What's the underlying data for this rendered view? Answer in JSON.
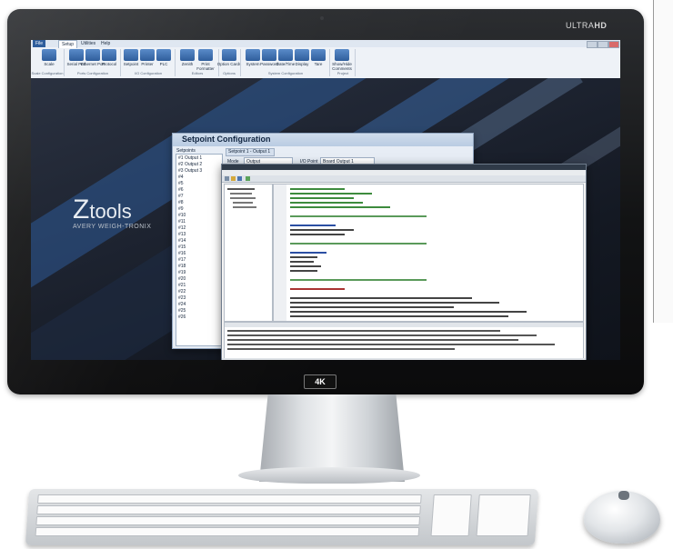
{
  "monitor": {
    "brand_label_light": "ULTRA",
    "brand_label_bold": "HD",
    "badge": "4K"
  },
  "menubar": {
    "items": [
      "File",
      "Setup",
      "Utilities",
      "Help"
    ]
  },
  "ribbon": {
    "buttons": [
      "Scale",
      "Serial Port",
      "Ethernet Port",
      "Protocol",
      "Setpoint",
      "Printer",
      "PLC",
      "Zenith",
      "Print Formatter",
      "Option Cards",
      "System",
      "Password",
      "Date/Time",
      "Display",
      "Tare",
      "Show/Hide Comments"
    ],
    "groups": [
      "Scale Configuration",
      "Ports Configuration",
      "I/O Configuration",
      "Editors",
      "Options",
      "System Configuration",
      "Project"
    ]
  },
  "desktop": {
    "logo_z": "Z",
    "logo_text": "tools",
    "logo_sub": "AVERY WEIGH-TRONIX"
  },
  "setpoint_window": {
    "title": "Setpoint Configuration",
    "list_label": "Setpoints",
    "items": [
      "#1 Output 1",
      "#2 Output 2",
      "#3 Output 3",
      "#4",
      "#5",
      "#6",
      "#7",
      "#8",
      "#9",
      "#10",
      "#11",
      "#12",
      "#13",
      "#14",
      "#15",
      "#16",
      "#17",
      "#18",
      "#19",
      "#20",
      "#21",
      "#22",
      "#23",
      "#24",
      "#25",
      "#26"
    ],
    "tab": "Setpoint 1 - Output 1",
    "mode_label": "Mode",
    "mode_value": "Output",
    "io_point_label": "I/O Point",
    "io_point_value": "Board Output 1"
  },
  "colors": {
    "ribbon_icon": "#3b6fb0",
    "desktop_dark": "#141923",
    "stripe_blue": "#3d74b8",
    "stripe_light": "#8fa9c9"
  }
}
